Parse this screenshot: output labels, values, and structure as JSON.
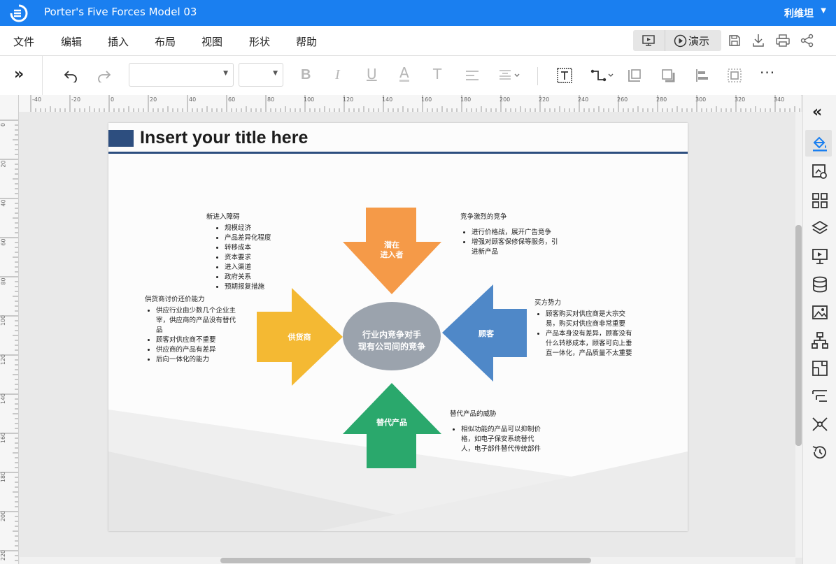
{
  "window": {
    "title": "Porter's Five Forces Model 03",
    "user": "利维坦"
  },
  "menu": [
    {
      "id": "file",
      "label": "文件"
    },
    {
      "id": "edit",
      "label": "编辑"
    },
    {
      "id": "insert",
      "label": "插入"
    },
    {
      "id": "layout",
      "label": "布局"
    },
    {
      "id": "view",
      "label": "视图"
    },
    {
      "id": "shape",
      "label": "形状"
    },
    {
      "id": "help",
      "label": "帮助"
    }
  ],
  "present": {
    "label": "演示"
  },
  "toolbar": {
    "font_family_value": "",
    "font_size_value": ""
  },
  "ruler": {
    "h": [
      "-40",
      "-20",
      "0",
      "20",
      "40",
      "60",
      "80",
      "100",
      "120",
      "140",
      "160",
      "180",
      "200",
      "220",
      "240",
      "260",
      "280",
      "300",
      "320",
      "340"
    ],
    "v": [
      "0",
      "20",
      "40",
      "60",
      "80",
      "100",
      "120",
      "140",
      "160",
      "180",
      "200",
      "220"
    ]
  },
  "diagram": {
    "title": "Insert your title here",
    "colors": {
      "accent": "#2d4e7f",
      "entrants": "#f59a48",
      "suppliers": "#f4b933",
      "buyers": "#4f88c8",
      "substitutes": "#2aa86c",
      "center": "#9ba3ad"
    },
    "center": {
      "line1": "行业内竞争对手",
      "line2": "现有公司间的竞争"
    },
    "entrants": {
      "line1": "潜在",
      "line2": "进入者"
    },
    "suppliers": {
      "label": "供货商"
    },
    "buyers": {
      "label": "顾客"
    },
    "substitutes": {
      "label": "替代产品"
    },
    "notes": {
      "barriers": {
        "title": "新进入障碍",
        "items": [
          "规模经济",
          "产品差异化程度",
          "转移成本",
          "资本要求",
          "进入渠道",
          "政府关系",
          "预期报复措施"
        ]
      },
      "rivalry": {
        "title": "竞争激烈的竞争",
        "items": [
          "进行价格战，展开广告竞争",
          "增强对顾客保修保等服务，引进新产品"
        ]
      },
      "supplier_power": {
        "title": "供货商讨价还价能力",
        "items": [
          "供应行业由少数几个企业主宰，供应商的产品没有替代品",
          "顾客对供应商不重要",
          "供应商的产品有差异",
          "后向一体化的能力"
        ]
      },
      "buyer_power": {
        "title": "买方势力",
        "items": [
          "顾客购买对供应商是大宗交易，购买对供应商非常重要",
          "产品本身没有差异，顾客没有什么转移成本，顾客可向上垂直一体化，产品质量不太重要"
        ]
      },
      "substitutes": {
        "title": "替代产品的威胁",
        "items": [
          "相似功能的产品可以抑制价格，如电子保安系统替代人，电子部件替代传统部件"
        ]
      }
    }
  }
}
